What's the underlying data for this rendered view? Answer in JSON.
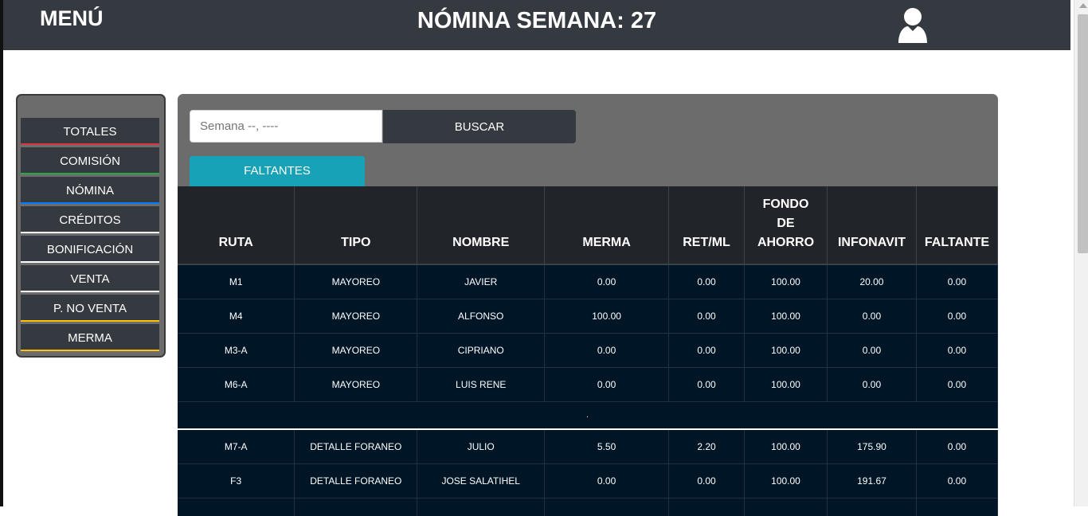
{
  "header": {
    "menu_label": "MENÚ",
    "title": "NÓMINA SEMANA: 27",
    "user_icon": "user-icon"
  },
  "sidebar": {
    "items": [
      {
        "label": "TOTALES",
        "accent": "#dc3545"
      },
      {
        "label": "COMISIÓN",
        "accent": "#28a745"
      },
      {
        "label": "NÓMINA",
        "accent": "#007bff"
      },
      {
        "label": "CRÉDITOS",
        "accent": "#ffffff"
      },
      {
        "label": "BONIFICACIÓN",
        "accent": "#ffffff"
      },
      {
        "label": "VENTA",
        "accent": "#ffffff"
      },
      {
        "label": "P. NO VENTA",
        "accent": "#ffc107"
      },
      {
        "label": "MERMA",
        "accent": "#ffc107"
      }
    ]
  },
  "search": {
    "placeholder": "Semana --, ----",
    "button_label": "BUSCAR"
  },
  "tabs": {
    "active_label": "FALTANTES"
  },
  "table": {
    "headers": [
      "RUTA",
      "TIPO",
      "NOMBRE",
      "MERMA",
      "RET/ML",
      "FONDO DE AHORRO",
      "INFONAVIT",
      "FALTANTE"
    ],
    "header_lines": {
      "fondo_1": "FONDO",
      "fondo_2": "DE",
      "fondo_3": "AHORRO"
    },
    "group1": [
      [
        "M1",
        "MAYOREO",
        "JAVIER",
        "0.00",
        "0.00",
        "100.00",
        "20.00",
        "0.00"
      ],
      [
        "M4",
        "MAYOREO",
        "ALFONSO",
        "100.00",
        "0.00",
        "100.00",
        "0.00",
        "0.00"
      ],
      [
        "M3-A",
        "MAYOREO",
        "CIPRIANO",
        "0.00",
        "0.00",
        "100.00",
        "0.00",
        "0.00"
      ],
      [
        "M6-A",
        "MAYOREO",
        "LUIS RENE",
        "0.00",
        "0.00",
        "100.00",
        "0.00",
        "0.00"
      ]
    ],
    "separator_text": ".",
    "group2": [
      [
        "M7-A",
        "DETALLE FORANEO",
        "JULIO",
        "5.50",
        "2.20",
        "100.00",
        "175.90",
        "0.00"
      ],
      [
        "F3",
        "DETALLE FORANEO",
        "JOSE SALATIHEL",
        "0.00",
        "0.00",
        "100.00",
        "191.67",
        "0.00"
      ],
      [
        "",
        "",
        "",
        "",
        "",
        "",
        "",
        ""
      ]
    ]
  }
}
